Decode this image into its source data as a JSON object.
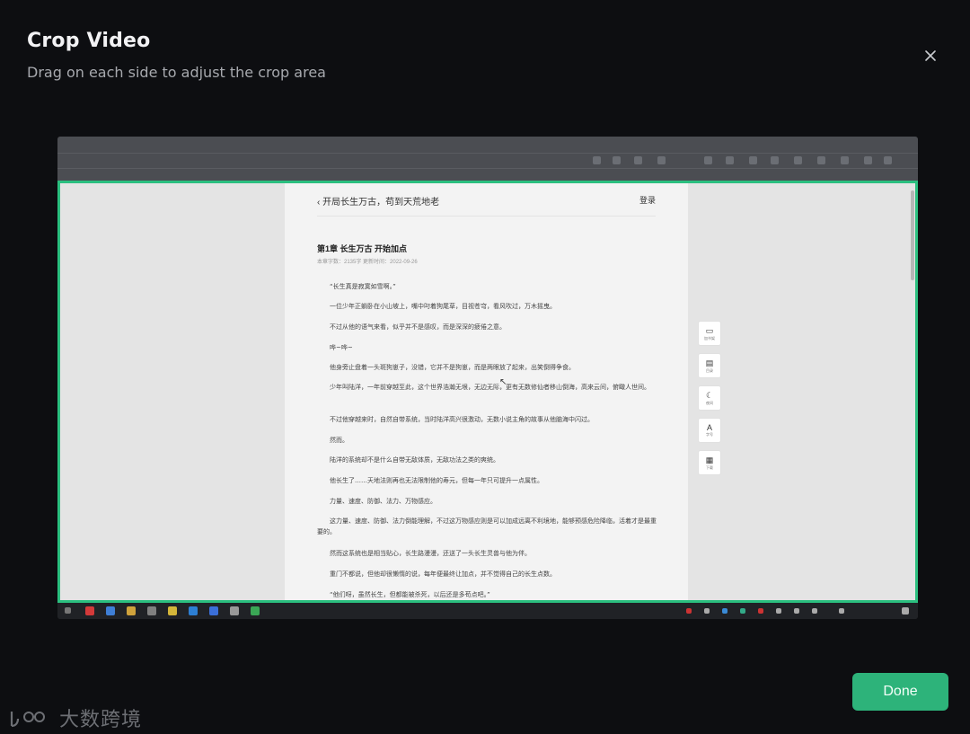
{
  "dialog": {
    "title": "Crop Video",
    "subtitle": "Drag on each side to adjust the crop area",
    "close_icon": "close-icon",
    "done_label": "Done"
  },
  "video": {
    "page": {
      "back_text": "开局长生万古，苟到天荒地老",
      "login_text": "登录",
      "chapter_title": "第1章 长生万古 开始加点",
      "meta": "本章字数：2135字     更新时间：2022-09-26",
      "paragraphs": [
        "“长生真是寂寞如雪啊。”",
        "一位少年正躺卧在小山坡上，嘴中叼着狗尾草，目视苍穹，看风吹过，万木摇曳。",
        "不过从他的语气来看，似乎并不是感叹，而是深深的疲倦之意。",
        "哗~哗~",
        "他身旁止盘着一头斑狗崽子，没错，它并不是狗崽，而是两眼放了起来，出笑倒得争食。",
        "少年叫陆洋，一年前穿越至此，这个世界浩瀚无垠，无边无际，更有无数修仙者移山倒海，高来云间，俯瞰人世间。",
        "不过他穿越来时，自然自带系统，当时陆洋高兴很激动，无数小说主角的故事从他脑海中闪过。",
        "然而。",
        "陆洋的系统却不是什么自带无敌体质，无敌功法之类的爽统。",
        "他长生了……天地法则再也无法限制他的寿元，但每一年只可提升一点属性。",
        "力量、速度、防御、法力、万物感应。",
        "这力量、速度、防御、法力倒能理解，不过这万物感应则是可以加成远离不利境地，能够预感危险降临，活着才是最重要的。",
        "然而这系统也是相当贴心，长生路漫漫，还送了一头长生灵兽与他为伴。",
        "重门不都说，但他却很懒惰的说，每年便最终让加点，并不觉得自己的长生点数。",
        "“他们呀，虽然长生，但都能被杀死，以后还是多苟点吧。”"
      ],
      "tools": [
        {
          "icon": "book-icon",
          "label": "加书架"
        },
        {
          "icon": "note-icon",
          "label": "目录"
        },
        {
          "icon": "moon-icon",
          "label": "夜间"
        },
        {
          "icon": "font-icon",
          "label": "字号"
        },
        {
          "icon": "grid-icon",
          "label": "下载"
        }
      ]
    }
  },
  "watermark": {
    "text": "大数跨境"
  },
  "colors": {
    "accent": "#2bbf7f",
    "done_bg": "#2db37a",
    "background": "#0d0e11"
  }
}
